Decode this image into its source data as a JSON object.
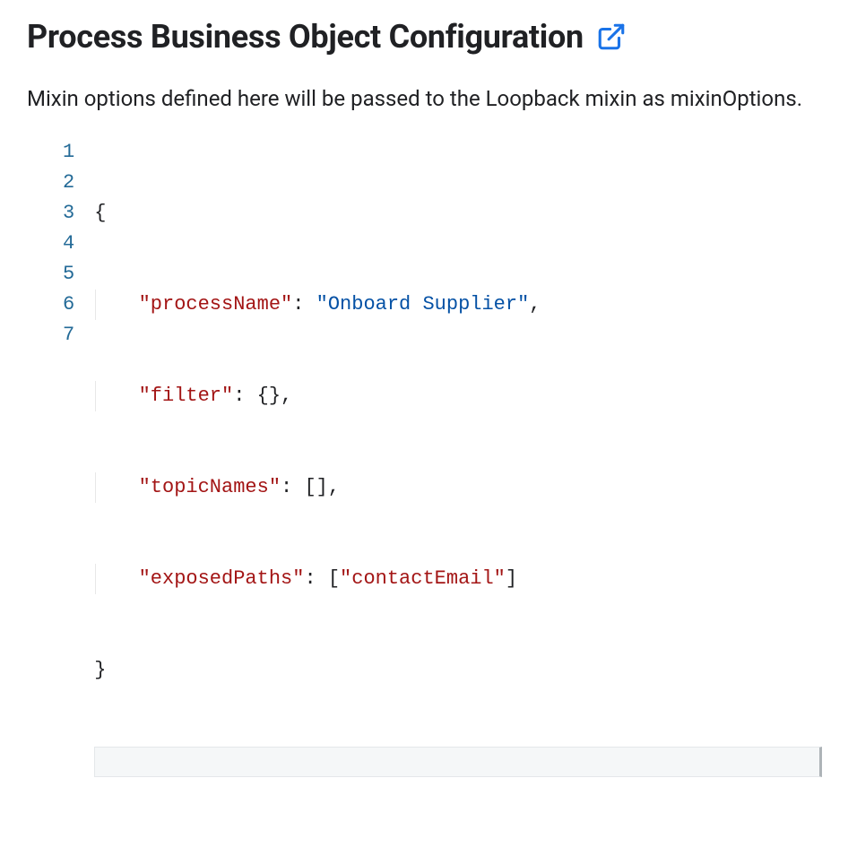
{
  "header": {
    "title": "Process Business Object Configuration"
  },
  "description": "Mixin options defined here will be passed to the Loopback mixin as mixinOptions.",
  "editor": {
    "lineNumbers": [
      "1",
      "2",
      "3",
      "4",
      "5",
      "6",
      "7"
    ],
    "keys": {
      "processName": "\"processName\"",
      "filter": "\"filter\"",
      "topicNames": "\"topicNames\"",
      "exposedPaths": "\"exposedPaths\""
    },
    "values": {
      "processName": "\"Onboard Supplier\"",
      "filter": "{}",
      "topicNames": "[]",
      "exposedPaths_open": "[",
      "exposedPaths_item": "\"contactEmail\"",
      "exposedPaths_close": "]"
    },
    "braces": {
      "open": "{",
      "close": "}"
    },
    "punct": {
      "colon": ": ",
      "comma": ","
    }
  }
}
